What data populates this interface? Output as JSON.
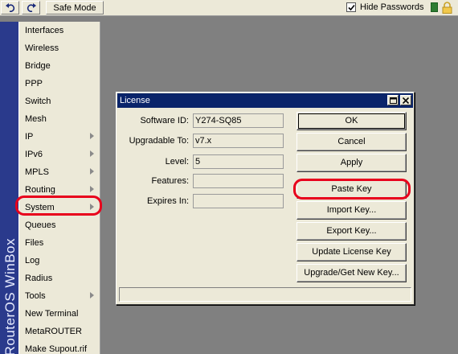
{
  "toolbar": {
    "undo_icon": "undo-icon",
    "redo_icon": "redo-icon",
    "safe_mode_label": "Safe Mode",
    "hide_passwords_label": "Hide Passwords",
    "hide_passwords_checked": true,
    "status_color": "#2e7d32"
  },
  "brand": {
    "text": "RouterOS WinBox"
  },
  "menu": {
    "items": [
      {
        "label": "Interfaces",
        "submenu": false
      },
      {
        "label": "Wireless",
        "submenu": false
      },
      {
        "label": "Bridge",
        "submenu": false
      },
      {
        "label": "PPP",
        "submenu": false
      },
      {
        "label": "Switch",
        "submenu": false
      },
      {
        "label": "Mesh",
        "submenu": false
      },
      {
        "label": "IP",
        "submenu": true
      },
      {
        "label": "IPv6",
        "submenu": true
      },
      {
        "label": "MPLS",
        "submenu": true
      },
      {
        "label": "Routing",
        "submenu": true
      },
      {
        "label": "System",
        "submenu": true
      },
      {
        "label": "Queues",
        "submenu": false
      },
      {
        "label": "Files",
        "submenu": false
      },
      {
        "label": "Log",
        "submenu": false
      },
      {
        "label": "Radius",
        "submenu": false
      },
      {
        "label": "Tools",
        "submenu": true
      },
      {
        "label": "New Terminal",
        "submenu": false
      },
      {
        "label": "MetaROUTER",
        "submenu": false
      },
      {
        "label": "Make Supout.rif",
        "submenu": false
      }
    ],
    "highlighted": "System",
    "highlight_color": "#e8001c"
  },
  "dialog": {
    "title": "License",
    "fields": [
      {
        "label": "Software ID:",
        "value": "Y274-SQ85"
      },
      {
        "label": "Upgradable To:",
        "value": "v7.x"
      },
      {
        "label": "Level:",
        "value": "5"
      },
      {
        "label": "Features:",
        "value": ""
      },
      {
        "label": "Expires In:",
        "value": ""
      }
    ],
    "buttons": [
      {
        "label": "OK"
      },
      {
        "label": "Cancel"
      },
      {
        "label": "Apply"
      },
      {
        "label": "Paste Key"
      },
      {
        "label": "Import Key..."
      },
      {
        "label": "Export Key..."
      },
      {
        "label": "Update License Key"
      },
      {
        "label": "Upgrade/Get New Key..."
      }
    ],
    "highlighted_button": "Paste Key"
  }
}
